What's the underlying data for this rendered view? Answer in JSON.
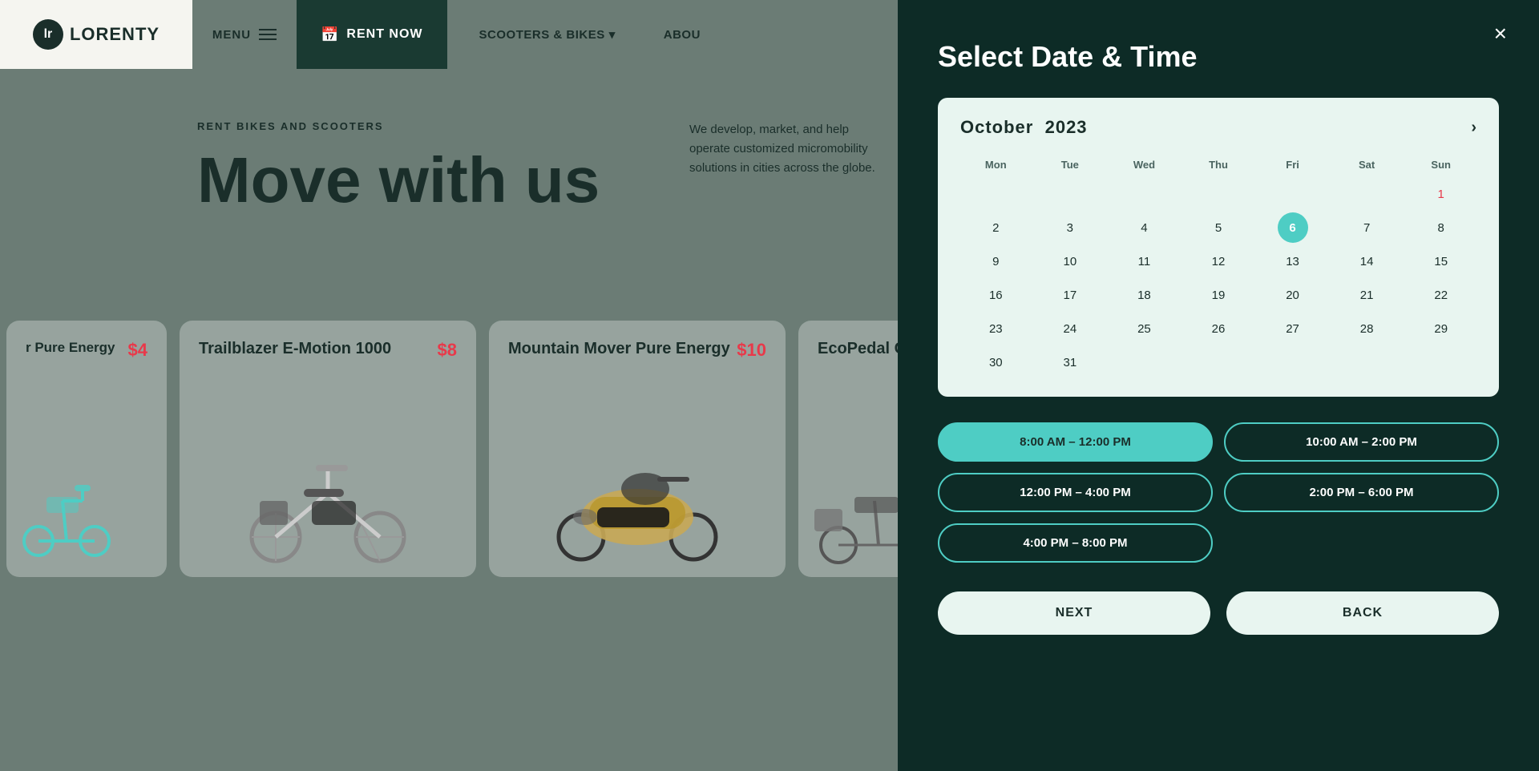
{
  "header": {
    "logo_text": "LORENTY",
    "menu_label": "MENU",
    "rent_now_label": "RENT NOW",
    "nav_items": [
      {
        "label": "SCOOTERS & BIKES",
        "has_arrow": true
      },
      {
        "label": "ABOU"
      }
    ]
  },
  "hero": {
    "subtitle": "RENT BIKES AND SCOOTERS",
    "title": "Move with us",
    "description": "We develop, market, and help operate customized micromobility solutions in cities across the globe."
  },
  "products": [
    {
      "name": "r Pure Energy",
      "price": "$4",
      "partial": true
    },
    {
      "name": "Trailblazer E-Motion 1000",
      "price": "$8"
    },
    {
      "name": "Mountain Mover Pure Energy",
      "price": "$10"
    },
    {
      "name": "EcoPedal Cl",
      "price": "",
      "partial": true
    }
  ],
  "panel": {
    "title": "Select Date & Time",
    "close_label": "×",
    "calendar": {
      "month": "October",
      "year": "2023",
      "nav_next": "›",
      "day_headers": [
        "Mon",
        "Tue",
        "Wed",
        "Thu",
        "Fri",
        "Sat",
        "Sun"
      ],
      "weeks": [
        [
          null,
          null,
          null,
          null,
          null,
          null,
          {
            "day": 1,
            "type": "sunday"
          }
        ],
        [
          {
            "day": 2
          },
          {
            "day": 3
          },
          {
            "day": 4
          },
          {
            "day": 5
          },
          {
            "day": 6,
            "selected": true
          },
          {
            "day": 7
          },
          {
            "day": 8
          }
        ],
        [
          {
            "day": 9
          },
          {
            "day": 10
          },
          {
            "day": 11
          },
          {
            "day": 12
          },
          {
            "day": 13
          },
          {
            "day": 14
          },
          {
            "day": 15
          }
        ],
        [
          {
            "day": 16
          },
          {
            "day": 17
          },
          {
            "day": 18
          },
          {
            "day": 19
          },
          {
            "day": 20
          },
          {
            "day": 21
          },
          {
            "day": 22
          }
        ],
        [
          {
            "day": 23
          },
          {
            "day": 24
          },
          {
            "day": 25
          },
          {
            "day": 26
          },
          {
            "day": 27
          },
          {
            "day": 28
          },
          {
            "day": 29
          }
        ],
        [
          {
            "day": 30
          },
          {
            "day": 31
          },
          null,
          null,
          null,
          null,
          null
        ]
      ]
    },
    "time_slots": [
      {
        "label": "8:00 AM – 12:00 PM",
        "selected": true
      },
      {
        "label": "10:00 AM – 2:00 PM",
        "selected": false
      },
      {
        "label": "12:00 PM – 4:00 PM",
        "selected": false
      },
      {
        "label": "2:00 PM – 6:00 PM",
        "selected": false
      },
      {
        "label": "4:00 PM – 8:00 PM",
        "selected": false
      }
    ],
    "buttons": {
      "next": "NEXT",
      "back": "BACK"
    }
  }
}
